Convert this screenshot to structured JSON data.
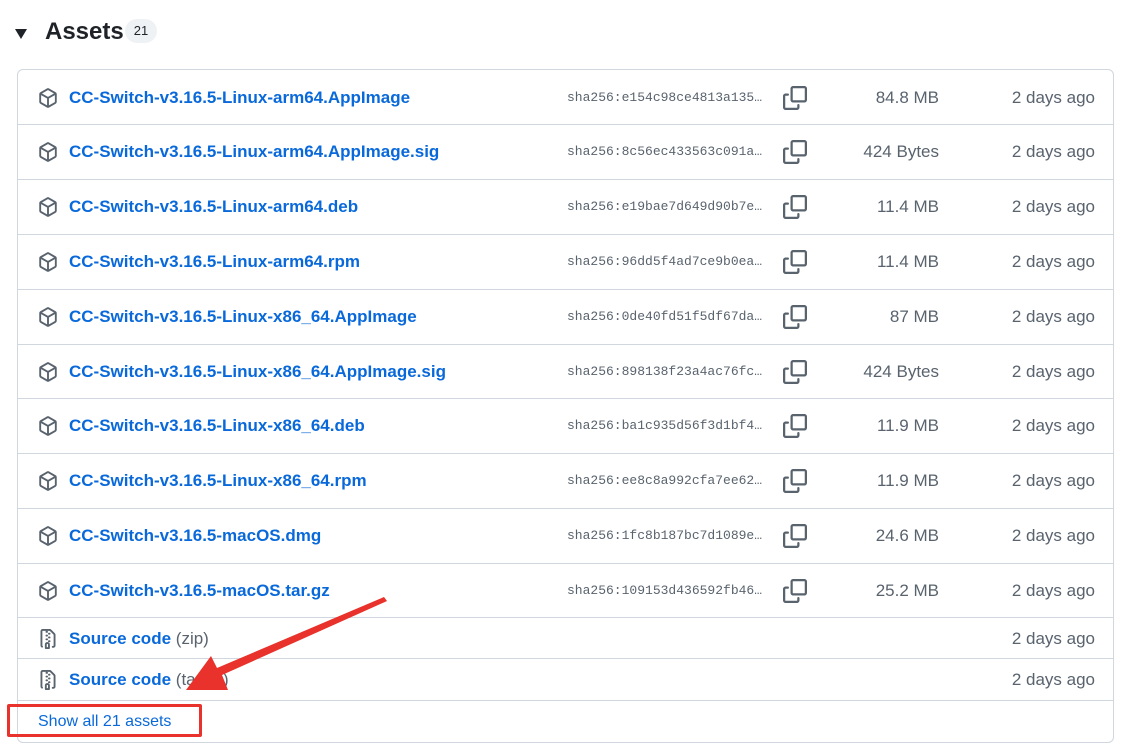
{
  "header": {
    "title": "Assets",
    "count": "21"
  },
  "assets": [
    {
      "name": "CC-Switch-v3.16.5-Linux-arm64.AppImage",
      "sha": "sha256:e154c98ce4813a135…",
      "size": "84.8 MB",
      "date": "2 days ago"
    },
    {
      "name": "CC-Switch-v3.16.5-Linux-arm64.AppImage.sig",
      "sha": "sha256:8c56ec433563c091a…",
      "size": "424 Bytes",
      "date": "2 days ago"
    },
    {
      "name": "CC-Switch-v3.16.5-Linux-arm64.deb",
      "sha": "sha256:e19bae7d649d90b7e…",
      "size": "11.4 MB",
      "date": "2 days ago"
    },
    {
      "name": "CC-Switch-v3.16.5-Linux-arm64.rpm",
      "sha": "sha256:96dd5f4ad7ce9b0ea…",
      "size": "11.4 MB",
      "date": "2 days ago"
    },
    {
      "name": "CC-Switch-v3.16.5-Linux-x86_64.AppImage",
      "sha": "sha256:0de40fd51f5df67da…",
      "size": "87 MB",
      "date": "2 days ago"
    },
    {
      "name": "CC-Switch-v3.16.5-Linux-x86_64.AppImage.sig",
      "sha": "sha256:898138f23a4ac76fc…",
      "size": "424 Bytes",
      "date": "2 days ago"
    },
    {
      "name": "CC-Switch-v3.16.5-Linux-x86_64.deb",
      "sha": "sha256:ba1c935d56f3d1bf4…",
      "size": "11.9 MB",
      "date": "2 days ago"
    },
    {
      "name": "CC-Switch-v3.16.5-Linux-x86_64.rpm",
      "sha": "sha256:ee8c8a992cfa7ee62…",
      "size": "11.9 MB",
      "date": "2 days ago"
    },
    {
      "name": "CC-Switch-v3.16.5-macOS.dmg",
      "sha": "sha256:1fc8b187bc7d1089e…",
      "size": "24.6 MB",
      "date": "2 days ago"
    },
    {
      "name": "CC-Switch-v3.16.5-macOS.tar.gz",
      "sha": "sha256:109153d436592fb46…",
      "size": "25.2 MB",
      "date": "2 days ago"
    }
  ],
  "source": [
    {
      "label": "Source code",
      "suffix": "(zip)",
      "date": "2 days ago"
    },
    {
      "label": "Source code",
      "suffix": "(tar.gz)",
      "date": "2 days ago"
    }
  ],
  "show_all_label": "Show all 21 assets",
  "colors": {
    "link": "#0969da",
    "muted": "#59636e",
    "border": "#d0d7de",
    "annotation": "#e8322b"
  },
  "icons": {
    "asset": "package-icon",
    "source": "file-zip-icon",
    "copy": "copy-icon",
    "collapse": "triangle-down-icon"
  }
}
